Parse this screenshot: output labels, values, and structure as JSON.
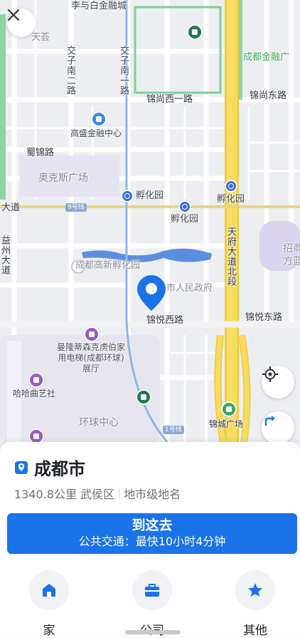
{
  "map": {
    "labels": {
      "li_bai": "李与白金融城",
      "tianhui": "天荟",
      "jiaozi_nan_er": "交子南二路",
      "jiaozi_nan_yi": "交子南一路",
      "chengdu_jinrong": "成都金融广",
      "jinshang_xi": "锦尚西一路",
      "jinshang_dong": "锦尚东路",
      "gaosheng": "高盛金融中心",
      "shujin": "蜀锦路",
      "aokesi": "奥克斯广场",
      "fuhuayuan_1": "孵化园",
      "fuhuayuan_2": "孵化园",
      "fuhuayuan_3": "孵化园",
      "datao": "大道",
      "tianfu_dadao_bei": "天府大道北段",
      "yizhou_dadao": "益州大道",
      "zhaoshang": "招商",
      "fang_lan": "方蓝",
      "gaoxin_fuhua": "成都高新孵化园",
      "shi_renmin": "市人民政府",
      "jinyue_xi": "锦悦西路",
      "jinyue_dong": "锦悦东路",
      "manlong": "曼隆蒂森克虏伯家用电梯(成都环球)展厅",
      "hahaqu": "哈哈曲艺社",
      "huanqiu": "环球中心",
      "jincheng": "锦城广场"
    },
    "metro_line_1": "1号线",
    "metro_line_9": "9号线"
  },
  "controls": {
    "close_icon": "close-icon",
    "locate_icon": "locate-icon",
    "route_icon": "route-icon"
  },
  "place": {
    "name": "成都市",
    "distance": "1340.8公里 武侯区",
    "type": "地市级地名"
  },
  "go": {
    "title": "到这去",
    "subtitle": "公共交通：最快10小时4分钟"
  },
  "quick": {
    "home": "家",
    "company": "公司",
    "other": "其他"
  },
  "colors": {
    "accent": "#1a73e8",
    "road_major": "#f7d74b",
    "water": "#5a8fe0",
    "park": "#8fd4a3"
  }
}
